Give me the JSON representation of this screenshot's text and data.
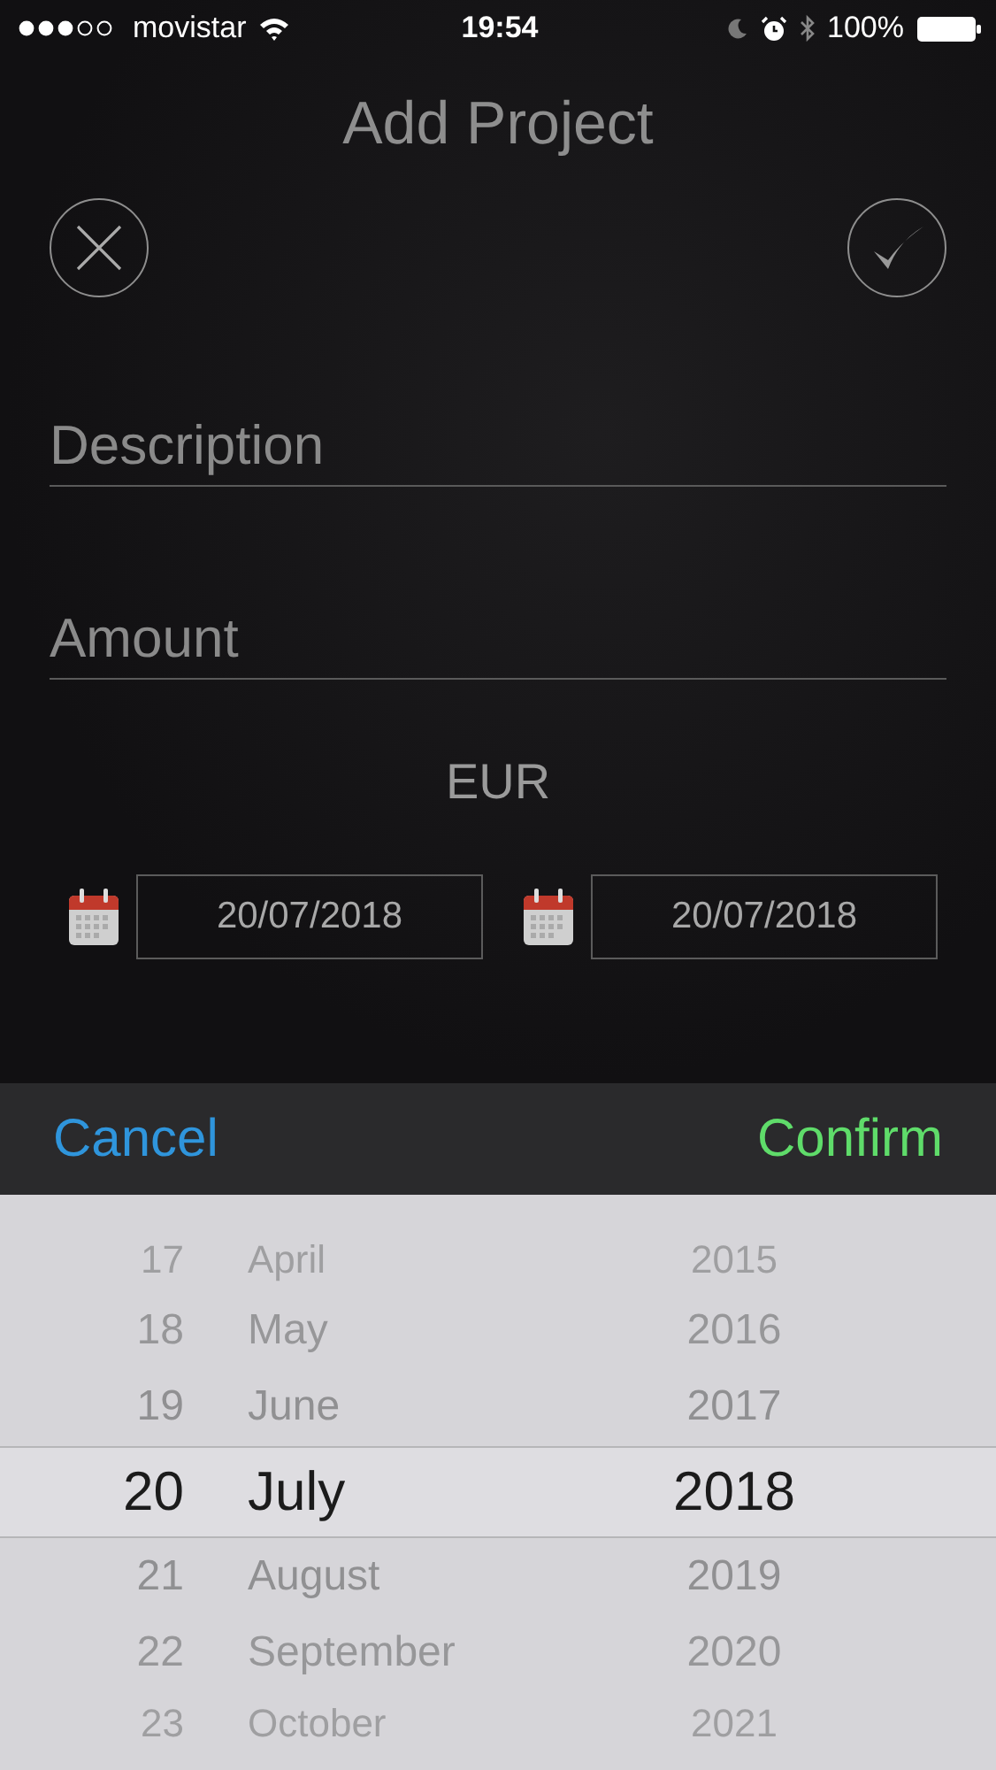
{
  "status_bar": {
    "carrier": "movistar",
    "time": "19:54",
    "battery": "100%"
  },
  "title": "Add Project",
  "form": {
    "description": {
      "placeholder": "Description"
    },
    "amount": {
      "placeholder": "Amount"
    },
    "currency": "EUR",
    "start_date": "20/07/2018",
    "end_date": "20/07/2018"
  },
  "toolbar": {
    "cancel": "Cancel",
    "confirm": "Confirm"
  },
  "picker": {
    "rows": [
      {
        "day": "17",
        "month": "April",
        "year": "2015",
        "selected": false
      },
      {
        "day": "18",
        "month": "May",
        "year": "2016",
        "selected": false
      },
      {
        "day": "19",
        "month": "June",
        "year": "2017",
        "selected": false
      },
      {
        "day": "20",
        "month": "July",
        "year": "2018",
        "selected": true
      },
      {
        "day": "21",
        "month": "August",
        "year": "2019",
        "selected": false
      },
      {
        "day": "22",
        "month": "September",
        "year": "2020",
        "selected": false
      },
      {
        "day": "23",
        "month": "October",
        "year": "2021",
        "selected": false
      }
    ]
  }
}
